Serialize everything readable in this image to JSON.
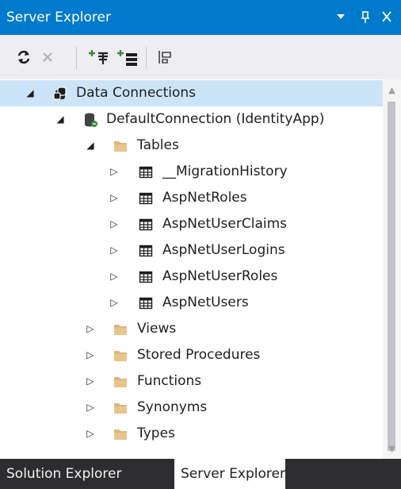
{
  "window": {
    "title": "Server Explorer",
    "buttons": {
      "dropdown": "▼",
      "pin": "ᵖ",
      "close": "✕"
    }
  },
  "toolbar": {
    "items": [
      {
        "name": "refresh-icon",
        "glyph": "⟳",
        "color": "#1e1e1e"
      },
      {
        "name": "stop-icon",
        "glyph": "✕",
        "color": "#b0b0b0"
      },
      {
        "name": "connect-database-icon",
        "glyph": "⁺⁺",
        "color": "#388a34"
      },
      {
        "name": "connect-server-icon",
        "glyph": "≡",
        "color": "#388a34"
      },
      {
        "name": "show-properties-icon",
        "glyph": "⊡",
        "color": "#424242"
      }
    ]
  },
  "tree": {
    "nodes": [
      {
        "label": "Data Connections",
        "expander": "◢",
        "icon": "data-connections-icon",
        "level": 0,
        "selected": true
      },
      {
        "label": "DefaultConnection (IdentityApp)",
        "expander": "◢",
        "icon": "database-icon",
        "level": 1,
        "selected": false
      },
      {
        "label": "Tables",
        "expander": "◢",
        "icon": "folder-icon",
        "level": 2,
        "selected": false
      },
      {
        "label": "__MigrationHistory",
        "expander": "▷",
        "icon": "table-icon",
        "level": 3,
        "selected": false
      },
      {
        "label": "AspNetRoles",
        "expander": "▷",
        "icon": "table-icon",
        "level": 3,
        "selected": false
      },
      {
        "label": "AspNetUserClaims",
        "expander": "▷",
        "icon": "table-icon",
        "level": 3,
        "selected": false
      },
      {
        "label": "AspNetUserLogins",
        "expander": "▷",
        "icon": "table-icon",
        "level": 3,
        "selected": false
      },
      {
        "label": "AspNetUserRoles",
        "expander": "▷",
        "icon": "table-icon",
        "level": 3,
        "selected": false
      },
      {
        "label": "AspNetUsers",
        "expander": "▷",
        "icon": "table-icon",
        "level": 3,
        "selected": false
      },
      {
        "label": "Views",
        "expander": "▷",
        "icon": "folder-icon",
        "level": 2,
        "selected": false
      },
      {
        "label": "Stored Procedures",
        "expander": "▷",
        "icon": "folder-icon",
        "level": 2,
        "selected": false
      },
      {
        "label": "Functions",
        "expander": "▷",
        "icon": "folder-icon",
        "level": 2,
        "selected": false
      },
      {
        "label": "Synonyms",
        "expander": "▷",
        "icon": "folder-icon",
        "level": 2,
        "selected": false
      },
      {
        "label": "Types",
        "expander": "▷",
        "icon": "folder-icon",
        "level": 2,
        "selected": false
      }
    ]
  },
  "scrollbar": {
    "up": "▲",
    "down": "▼"
  },
  "tabs": [
    {
      "label": "Solution Explorer",
      "active": false
    },
    {
      "label": "Server Explorer",
      "active": true
    }
  ],
  "colors": {
    "accent": "#007acc",
    "selection": "#cce4f7",
    "folder": "#dcb67a",
    "tab_bar": "#2d2d30"
  }
}
